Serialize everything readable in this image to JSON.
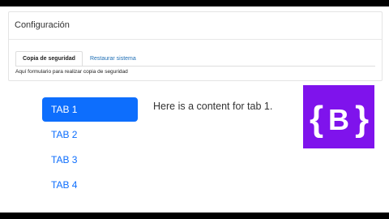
{
  "panel": {
    "title": "Configuración",
    "tabs": [
      {
        "label": "Copia de seguridad",
        "active": true
      },
      {
        "label": "Restaurar sistema",
        "active": false
      }
    ],
    "body_text": "Aquí formulario para realizar copia de seguridad"
  },
  "demo": {
    "pills": [
      {
        "label": "TAB 1",
        "active": true
      },
      {
        "label": "TAB 2",
        "active": false
      },
      {
        "label": "TAB 3",
        "active": false
      },
      {
        "label": "TAB 4",
        "active": false
      }
    ],
    "content_text": "Here is a content for tab 1."
  },
  "logo": {
    "letter": "B",
    "icon": "bootstrap-logo-icon"
  },
  "colors": {
    "accent": "#0d6efd",
    "brand": "#7f13ec"
  }
}
